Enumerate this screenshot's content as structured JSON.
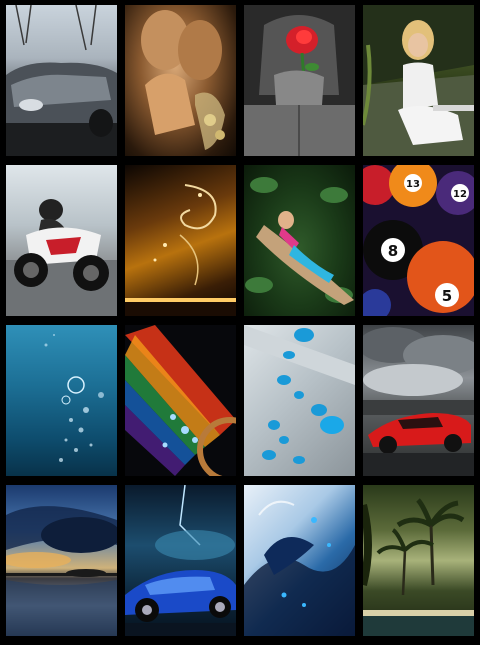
{
  "gallery": {
    "tiles": [
      {
        "id": "car-silver",
        "icon": "silver-sports-car-image"
      },
      {
        "id": "couple-kiss",
        "icon": "couple-kiss-image"
      },
      {
        "id": "rose-jeans",
        "icon": "rose-in-hands-image"
      },
      {
        "id": "blonde-woman",
        "icon": "blonde-woman-image"
      },
      {
        "id": "motorcycle",
        "icon": "sport-motorcycle-image"
      },
      {
        "id": "golden-swirl",
        "icon": "golden-swirl-image"
      },
      {
        "id": "woman-boat",
        "icon": "woman-in-boat-image"
      },
      {
        "id": "billiard-balls",
        "icon": "billiard-balls-image"
      },
      {
        "id": "underwater-bubbles",
        "icon": "underwater-bubbles-image"
      },
      {
        "id": "rainbow-cd",
        "icon": "rainbow-disc-image"
      },
      {
        "id": "water-drops",
        "icon": "water-drops-image"
      },
      {
        "id": "red-ferrari",
        "icon": "red-sports-car-image"
      },
      {
        "id": "sunset-sky",
        "icon": "sunset-sky-image"
      },
      {
        "id": "blue-sportscar",
        "icon": "blue-sports-car-image"
      },
      {
        "id": "blue-fractal",
        "icon": "blue-fractal-image"
      },
      {
        "id": "tropical-palms",
        "icon": "tropical-palms-image"
      }
    ],
    "background_color": "#000000"
  },
  "billiard_labels": [
    "13",
    "12",
    "8",
    "5"
  ]
}
